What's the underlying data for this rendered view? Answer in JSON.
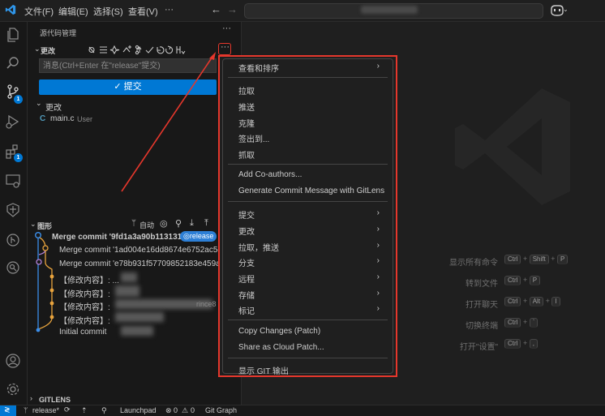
{
  "titlebar": {
    "menus": [
      "文件(F)",
      "编辑(E)",
      "选择(S)",
      "查看(V)",
      "···"
    ]
  },
  "activity_bar": {
    "badges": {
      "source_control": "1",
      "extensions": "1"
    }
  },
  "sidebar": {
    "header": "源代码管理",
    "changes_section": "更改",
    "commit_message_placeholder": "消息(Ctrl+Enter 在\"release\"提交)",
    "commit_button": "✓ 提交",
    "changes_group": "更改",
    "file": {
      "name": "main.c",
      "badge": "C",
      "hint": "User"
    },
    "graph_section": "图形",
    "graph_auto": "自动",
    "commits": [
      {
        "message": "Merge commit '9fd1a3a90b113131...",
        "tag": "release"
      },
      {
        "message": "Merge commit '1ad004e16dd8674e6752ac5c"
      },
      {
        "message": "Merge commit 'e78b931f57709852183e459a"
      },
      {
        "message": "【修改内容】: ..."
      },
      {
        "message": "【修改内容】:"
      },
      {
        "message": "【修改内容】:"
      },
      {
        "message": "【修改内容】:"
      },
      {
        "message": "Initial commit"
      }
    ],
    "rebase_hint": "rince8",
    "gitlens": "GITLENS"
  },
  "context_menu": {
    "groups": [
      [
        {
          "label": "查看和排序",
          "submenu": true
        }
      ],
      [
        {
          "label": "拉取"
        },
        {
          "label": "推送"
        },
        {
          "label": "克隆"
        },
        {
          "label": "签出到..."
        },
        {
          "label": "抓取"
        }
      ],
      [
        {
          "label": "Add Co-authors..."
        },
        {
          "label": "Generate Commit Message with GitLens"
        }
      ],
      [
        {
          "label": "提交",
          "submenu": true
        },
        {
          "label": "更改",
          "submenu": true
        },
        {
          "label": "拉取，推送",
          "submenu": true
        },
        {
          "label": "分支",
          "submenu": true
        },
        {
          "label": "远程",
          "submenu": true
        },
        {
          "label": "存储",
          "submenu": true
        },
        {
          "label": "标记",
          "submenu": true
        }
      ],
      [
        {
          "label": "Copy Changes (Patch)"
        },
        {
          "label": "Share as Cloud Patch..."
        }
      ],
      [
        {
          "label": "显示 GIT 输出"
        }
      ]
    ]
  },
  "editor": {
    "shortcuts": [
      {
        "label": "显示所有命令",
        "keys": [
          "Ctrl",
          "Shift",
          "P"
        ]
      },
      {
        "label": "转到文件",
        "keys": [
          "Ctrl",
          "P"
        ]
      },
      {
        "label": "打开聊天",
        "keys": [
          "Ctrl",
          "Alt",
          "I"
        ]
      },
      {
        "label": "切换终端",
        "keys": [
          "Ctrl",
          "`"
        ]
      },
      {
        "label": "打开\"设置\"",
        "keys": [
          "Ctrl",
          ","
        ]
      }
    ]
  },
  "statusbar": {
    "branch": "release*",
    "launchpad": "Launchpad",
    "problems": "0",
    "warnings": "0",
    "git_graph": "Git Graph"
  },
  "colors": {
    "accent": "#0078d4",
    "highlight": "#e5372c",
    "tag": "#2d7fd6"
  }
}
